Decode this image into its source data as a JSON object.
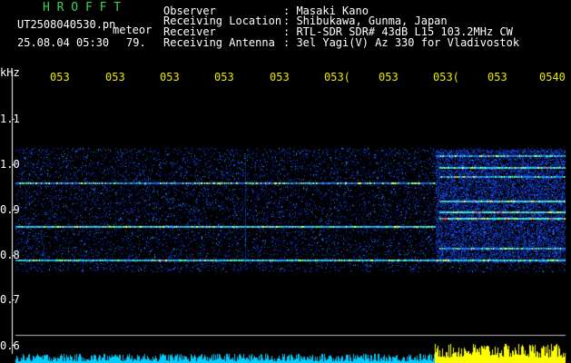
{
  "header": {
    "app_name": "H R O F F T",
    "filename": "UT2508040530.pn",
    "tag": "meteor",
    "datetime": "25.08.04 05:30",
    "count": "79.",
    "fields": [
      {
        "label": "Observer",
        "value": ": Masaki Kano"
      },
      {
        "label": "Receiving Location",
        "value": ": Shibukawa, Gunma, Japan"
      },
      {
        "label": "Receiver",
        "value": ": RTL-SDR SDR# 43dB L15 103.2MHz CW"
      },
      {
        "label": "Receiving Antenna",
        "value": ": 3el Yagi(V) Az 330 for Vladivostok"
      }
    ]
  },
  "time_axis": {
    "ticks": [
      "053",
      "053",
      "053",
      "053",
      "053",
      "053(",
      "053",
      "053(",
      "053",
      "0540"
    ]
  },
  "freq_axis": {
    "unit": "kHz",
    "labels": [
      "1.1",
      "1.0",
      "0.9",
      "0.8",
      "0.7",
      "0.6"
    ]
  },
  "colors": {
    "background": "#000000",
    "text": "#ffffff",
    "title": "#3ecf5a",
    "ticks": "#e8e800",
    "noise": "#1030c0",
    "hot": "#ff2020",
    "bar_low": "#00ccff",
    "bar_high": "#ffff00"
  }
}
